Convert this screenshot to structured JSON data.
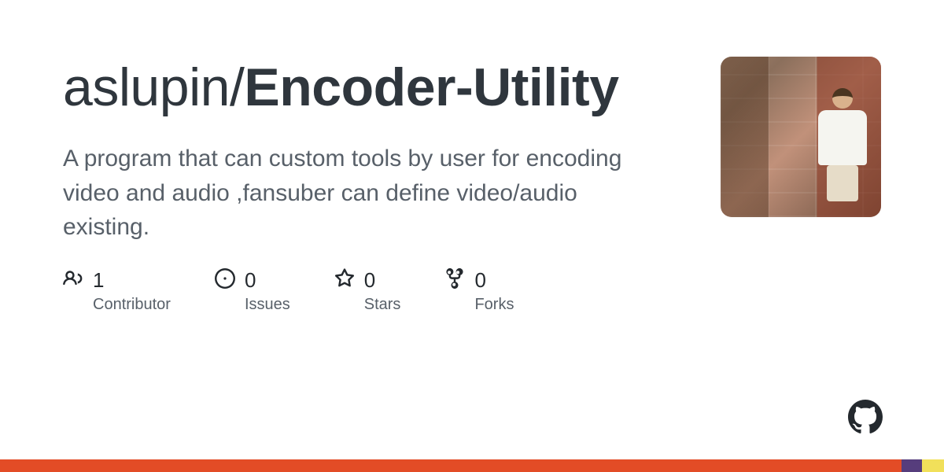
{
  "repo": {
    "owner": "aslupin",
    "slash": "/",
    "name_bold": "Encoder",
    "name_rest": "-Utility"
  },
  "description": "A program that can custom tools by user for encoding video and audio ,fansuber can define video/audio existing.",
  "stats": {
    "contributors": {
      "value": "1",
      "label": "Contributor"
    },
    "issues": {
      "value": "0",
      "label": "Issues"
    },
    "stars": {
      "value": "0",
      "label": "Stars"
    },
    "forks": {
      "value": "0",
      "label": "Forks"
    }
  },
  "language_bar": [
    {
      "color": "#e34c26",
      "pct": 95.5
    },
    {
      "color": "#563d7c",
      "pct": 2.2
    },
    {
      "color": "#f1e05a",
      "pct": 2.3
    }
  ]
}
